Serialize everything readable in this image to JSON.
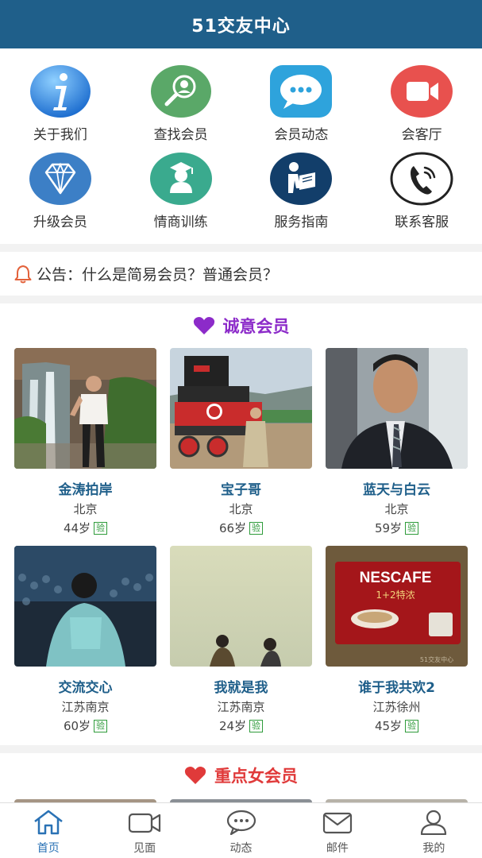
{
  "header": {
    "title": "51交友中心"
  },
  "menu": {
    "items": [
      {
        "label": "关于我们",
        "icon": "info-icon",
        "color": "#3a8de0"
      },
      {
        "label": "查找会员",
        "icon": "search-member-icon",
        "color": "#5aa868"
      },
      {
        "label": "会员动态",
        "icon": "chat-bubble-icon",
        "color": "#2ea3dc"
      },
      {
        "label": "会客厅",
        "icon": "video-camera-icon",
        "color": "#e8514e"
      },
      {
        "label": "升级会员",
        "icon": "diamond-icon",
        "color": "#3c7fc6"
      },
      {
        "label": "情商训练",
        "icon": "graduate-icon",
        "color": "#3aaa8e"
      },
      {
        "label": "服务指南",
        "icon": "reading-person-icon",
        "color": "#123e6a"
      },
      {
        "label": "联系客服",
        "icon": "phone-icon",
        "color": "#222222"
      }
    ]
  },
  "notice": {
    "text": "公告：什么是简易会员？普通会员？",
    "icon": "bell-icon",
    "icon_color": "#e3623b"
  },
  "section1": {
    "title": "诚意会员",
    "heart_color": "#8c2bc9",
    "members": [
      {
        "name": "金涛拍岸",
        "city": "北京",
        "age": "44岁",
        "badge": "验"
      },
      {
        "name": "宝子哥",
        "city": "北京",
        "age": "66岁",
        "badge": "验"
      },
      {
        "name": "蓝天与白云",
        "city": "北京",
        "age": "59岁",
        "badge": "验"
      },
      {
        "name": "交流交心",
        "city": "江苏南京",
        "age": "60岁",
        "badge": "验"
      },
      {
        "name": "我就是我",
        "city": "江苏南京",
        "age": "24岁",
        "badge": "验"
      },
      {
        "name": "谁于我共欢2",
        "city": "江苏徐州",
        "age": "45岁",
        "badge": "验"
      }
    ]
  },
  "section2": {
    "title": "重点女会员",
    "heart_color": "#e03a3a"
  },
  "tabbar": {
    "tabs": [
      {
        "label": "首页",
        "icon": "home-icon",
        "active": true
      },
      {
        "label": "见面",
        "icon": "video-icon",
        "active": false
      },
      {
        "label": "动态",
        "icon": "chat-icon",
        "active": false
      },
      {
        "label": "邮件",
        "icon": "mail-icon",
        "active": false
      },
      {
        "label": "我的",
        "icon": "user-icon",
        "active": false
      }
    ],
    "active_color": "#2a72b5"
  },
  "photo_texts": {
    "nescafe": "NESCAFE",
    "nescafe_sub": "1+2特浓",
    "watermark": "51交友中心"
  }
}
